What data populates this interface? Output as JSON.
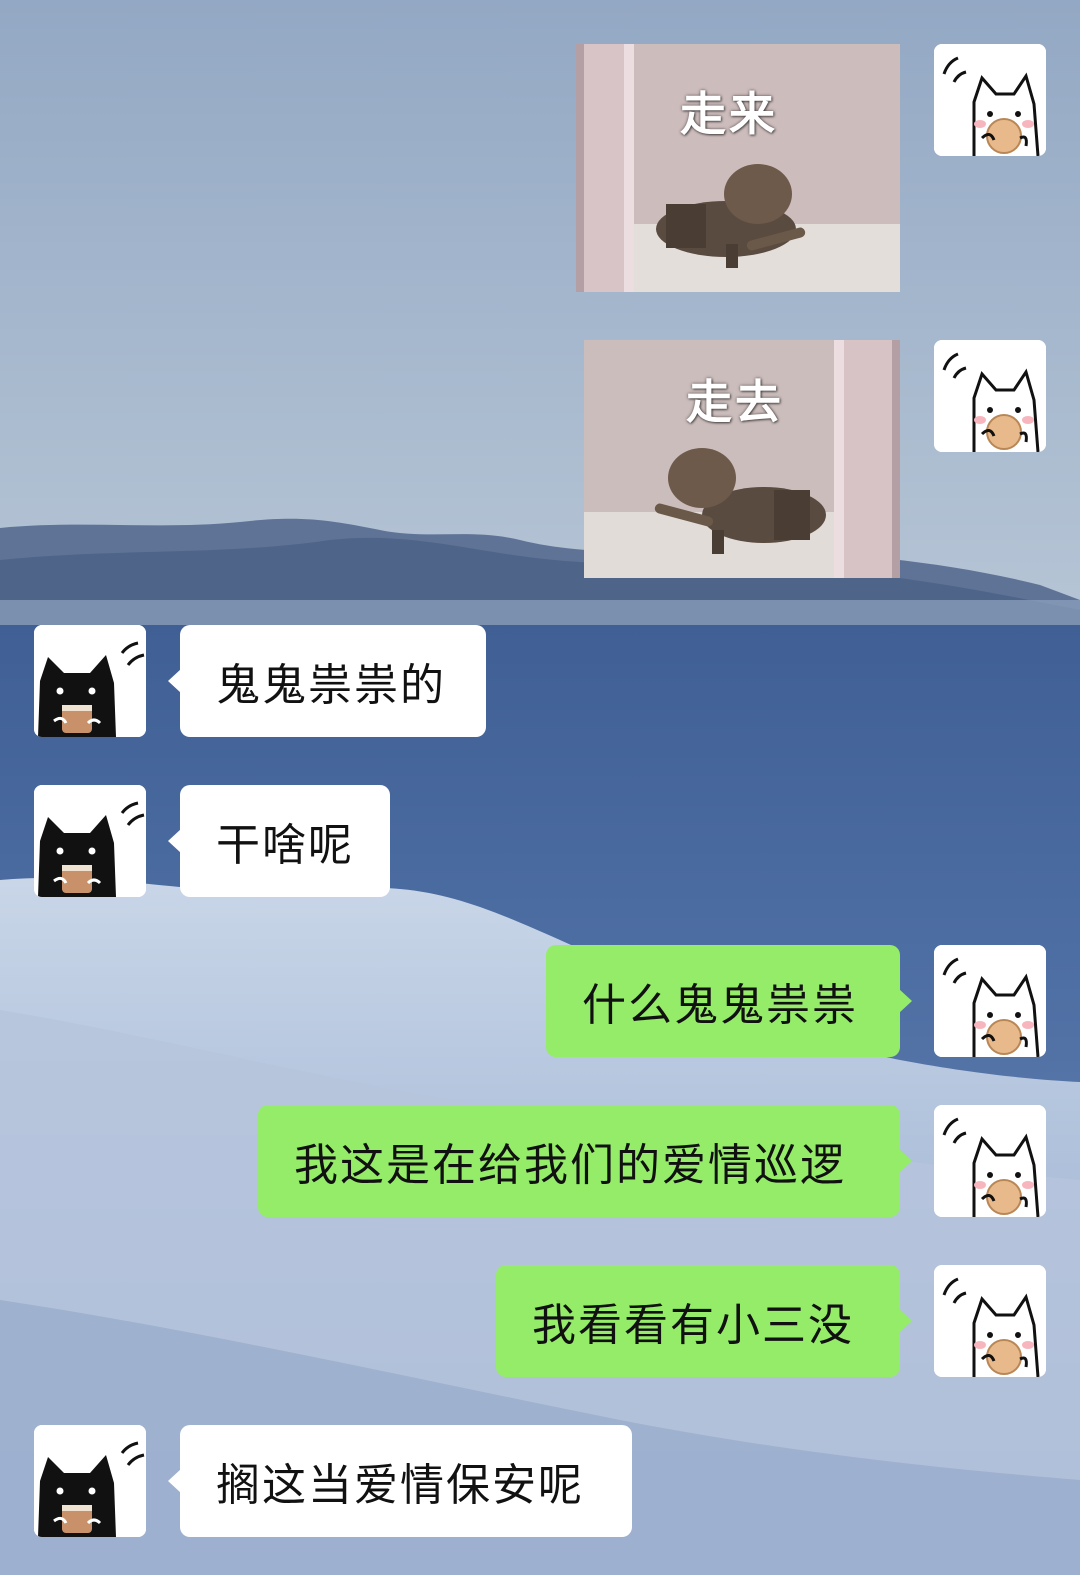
{
  "colors": {
    "sent_bubble": "#95ec69",
    "received_bubble": "#ffffff"
  },
  "avatars": {
    "me": "white-cat-eating-cookie",
    "other": "black-cat-holding-cup"
  },
  "messages": [
    {
      "sender": "me",
      "type": "sticker",
      "caption": "走来"
    },
    {
      "sender": "me",
      "type": "sticker",
      "caption": "走去"
    },
    {
      "sender": "other",
      "type": "text",
      "text": "鬼鬼祟祟的"
    },
    {
      "sender": "other",
      "type": "text",
      "text": "干啥呢"
    },
    {
      "sender": "me",
      "type": "text",
      "text": "什么鬼鬼祟祟"
    },
    {
      "sender": "me",
      "type": "text",
      "text": "我这是在给我们的爱情巡逻"
    },
    {
      "sender": "me",
      "type": "text",
      "text": "我看看有小三没"
    },
    {
      "sender": "other",
      "type": "text",
      "text": "搁这当爱情保安呢"
    }
  ]
}
